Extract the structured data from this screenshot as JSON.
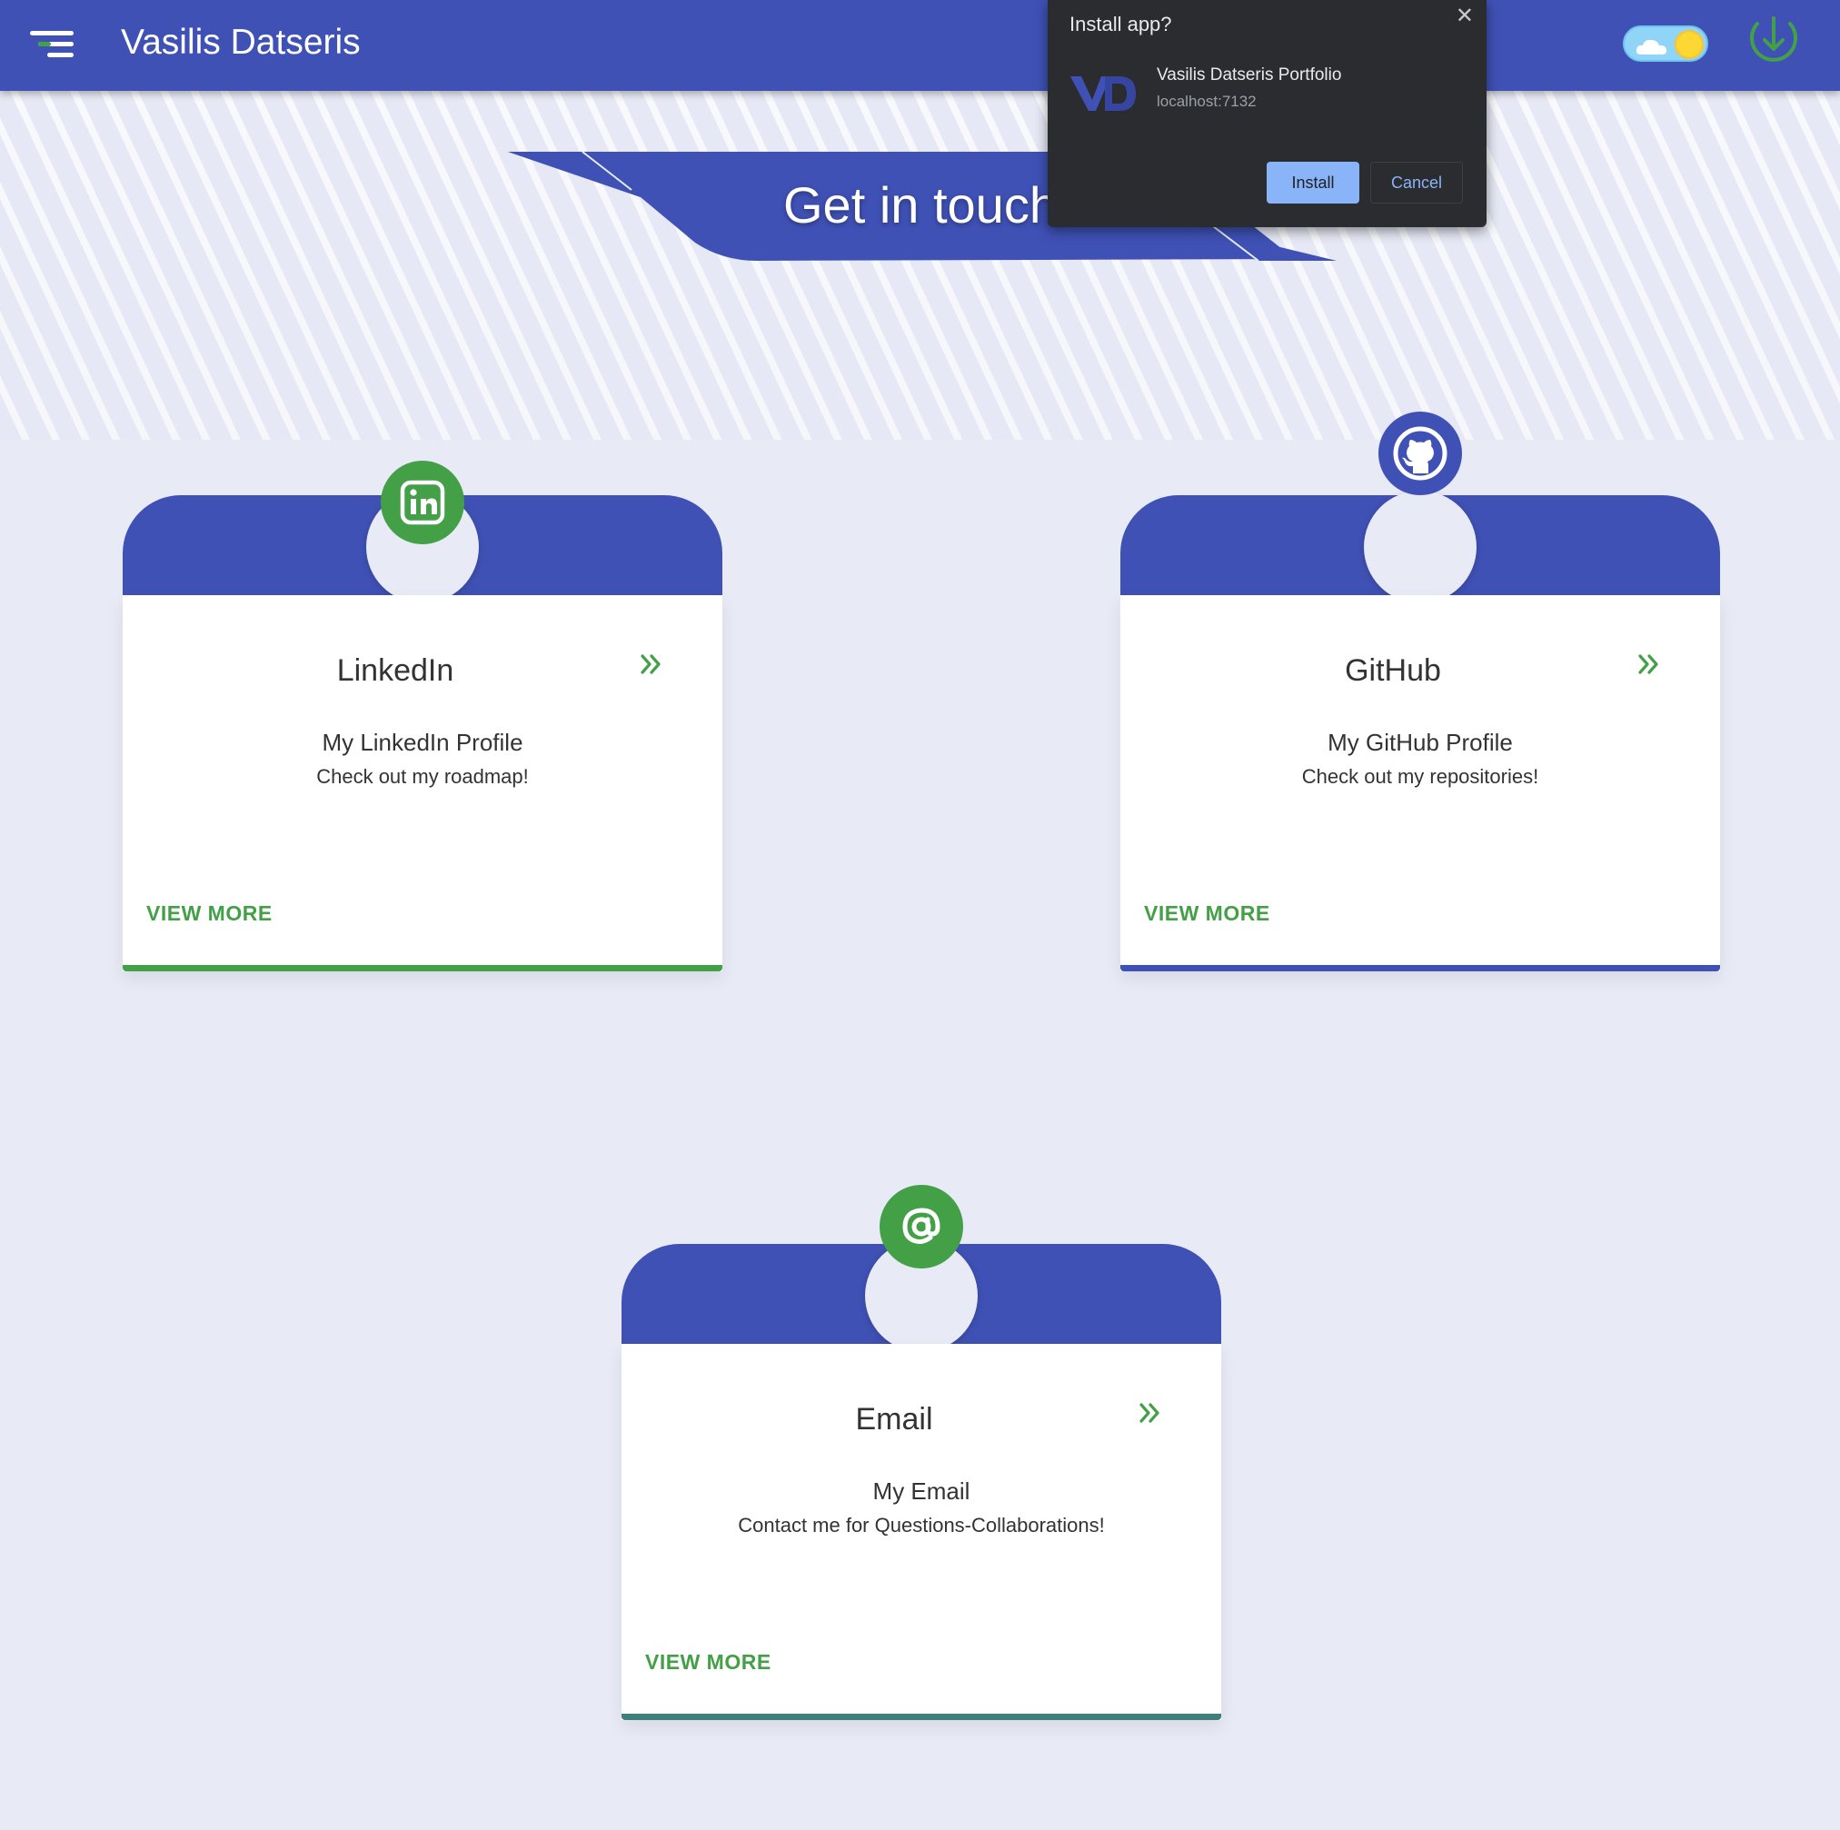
{
  "appbar": {
    "title": "Vasilis Datseris",
    "menu_icon": "menu-icon",
    "theme_icon": "sun-cloud-toggle-icon",
    "install_icon": "download-icon"
  },
  "hero": {
    "title": "Get in touch"
  },
  "colors": {
    "primary": "#3f51b5",
    "accent": "#43a047",
    "teal": "#3f7e7a",
    "background": "#e8eaf6"
  },
  "cards": [
    {
      "icon": "linkedin-icon",
      "title": "LinkedIn",
      "subtitle": "My LinkedIn Profile",
      "text": "Check out my roadmap!",
      "link": "VIEW MORE",
      "arrow_icon": "double-chevron-right-icon",
      "bottom_color": "#43a047"
    },
    {
      "icon": "github-icon",
      "title": "GitHub",
      "subtitle": "My GitHub Profile",
      "text": "Check out my repositories!",
      "link": "VIEW MORE",
      "arrow_icon": "double-chevron-right-icon",
      "bottom_color": "#3f51b5"
    },
    {
      "icon": "at-sign-icon",
      "title": "Email",
      "subtitle": "My Email",
      "text": "Contact me for Questions-Collaborations!",
      "link": "VIEW MORE",
      "arrow_icon": "double-chevron-right-icon",
      "bottom_color": "#3f7e7a"
    }
  ],
  "install_dialog": {
    "title": "Install app?",
    "app_name": "Vasilis Datseris Portfolio",
    "origin": "localhost:7132",
    "install_label": "Install",
    "cancel_label": "Cancel",
    "close_icon": "close-icon",
    "logo_icon": "vd-logo-icon"
  }
}
